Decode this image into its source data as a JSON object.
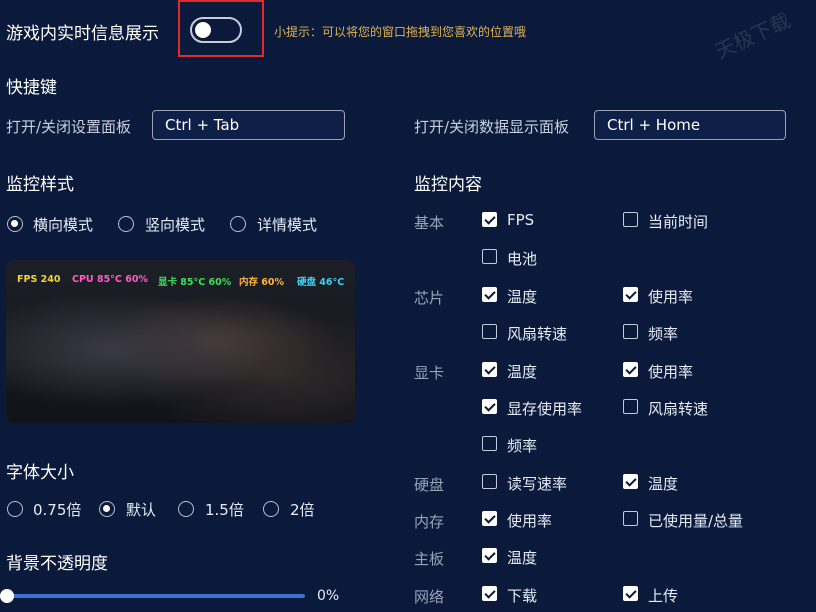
{
  "header": {
    "toggle_label": "游戏内实时信息展示",
    "toggle_on": false,
    "tip": "小提示：可以将您的窗口拖拽到您喜欢的位置哦",
    "watermark": "天极下载"
  },
  "shortcuts": {
    "title": "快捷键",
    "settings_label": "打开/关闭设置面板",
    "settings_key": "Ctrl + Tab",
    "data_label": "打开/关闭数据显示面板",
    "data_key": "Ctrl + Home"
  },
  "style": {
    "title": "监控样式",
    "modes": [
      {
        "label": "横向模式",
        "selected": true
      },
      {
        "label": "竖向模式",
        "selected": false
      },
      {
        "label": "详情模式",
        "selected": false
      }
    ],
    "preview": {
      "fps": {
        "text": "FPS 240",
        "color": "#f2d534"
      },
      "cpu": {
        "text": "CPU 85°C 60%",
        "color": "#ff5cc8"
      },
      "gpu": {
        "text": "显卡 85°C 60%",
        "color": "#3ee05a"
      },
      "mem": {
        "text": "内存 60%",
        "color": "#ffb640"
      },
      "disk": {
        "text": "硬盘 46°C",
        "color": "#3ed0f0"
      }
    }
  },
  "font_size": {
    "title": "字体大小",
    "options": [
      {
        "label": "0.75倍",
        "selected": false
      },
      {
        "label": "默认",
        "selected": true
      },
      {
        "label": "1.5倍",
        "selected": false
      },
      {
        "label": "2倍",
        "selected": false
      }
    ]
  },
  "opacity": {
    "title": "背景不透明度",
    "value_text": "0%",
    "value": 0
  },
  "monitor": {
    "title": "监控内容",
    "categories": {
      "basic": "基本",
      "chip": "芯片",
      "gpu": "显卡",
      "disk": "硬盘",
      "memory": "内存",
      "board": "主板",
      "network": "网络"
    },
    "items": {
      "fps": {
        "label": "FPS",
        "checked": true
      },
      "time": {
        "label": "当前时间",
        "checked": false
      },
      "battery": {
        "label": "电池",
        "checked": false
      },
      "chip_temp": {
        "label": "温度",
        "checked": true
      },
      "chip_usage": {
        "label": "使用率",
        "checked": true
      },
      "chip_fan": {
        "label": "风扇转速",
        "checked": false
      },
      "chip_freq": {
        "label": "频率",
        "checked": false
      },
      "gpu_temp": {
        "label": "温度",
        "checked": true
      },
      "gpu_usage": {
        "label": "使用率",
        "checked": true
      },
      "gpu_vram": {
        "label": "显存使用率",
        "checked": true
      },
      "gpu_fan": {
        "label": "风扇转速",
        "checked": false
      },
      "gpu_freq": {
        "label": "频率",
        "checked": false
      },
      "disk_rw": {
        "label": "读写速率",
        "checked": false
      },
      "disk_temp": {
        "label": "温度",
        "checked": true
      },
      "mem_usage": {
        "label": "使用率",
        "checked": true
      },
      "mem_used": {
        "label": "已使用量/总量",
        "checked": false
      },
      "board_temp": {
        "label": "温度",
        "checked": true
      },
      "net_down": {
        "label": "下载",
        "checked": true
      },
      "net_up": {
        "label": "上传",
        "checked": true
      }
    }
  }
}
